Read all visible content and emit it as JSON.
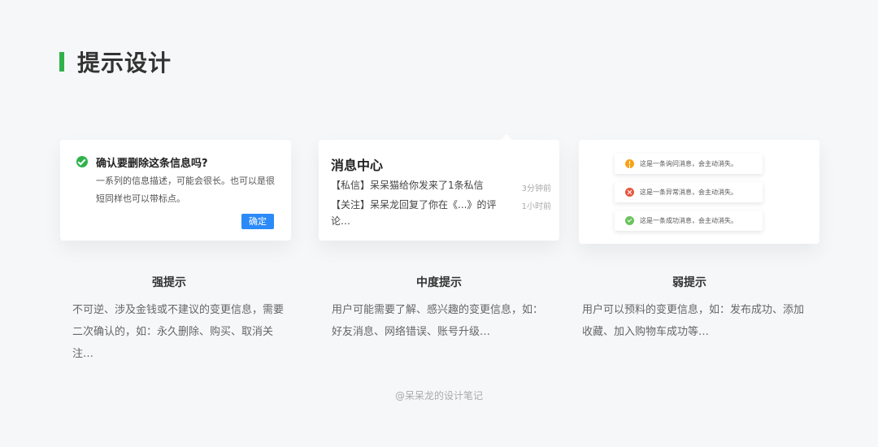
{
  "page": {
    "title": "提示设计",
    "accent_color": "#2fb24a",
    "footer": "@呆呆龙的设计笔记"
  },
  "strong": {
    "card": {
      "icon": "check-circle-icon",
      "title": "确认要删除这条信息吗?",
      "description": "一系列的信息描述，可能会很长。也可以是很短同样也可以带标点。",
      "confirm_label": "确定"
    },
    "heading": "强提示",
    "description": "不可逆、涉及金钱或不建议的变更信息，需要二次确认的，如：永久删除、购买、取消关注…"
  },
  "medium": {
    "card": {
      "title": "消息中心",
      "messages": [
        {
          "text": "【私信】呆呆猫给你发来了1条私信",
          "time": "3分钟前"
        },
        {
          "text": "【关注】呆呆龙回复了你在《...》的评论…",
          "time": "1小时前"
        }
      ]
    },
    "heading": "中度提示",
    "description": "用户可能需要了解、感兴趣的变更信息，如：好友消息、网络错误、账号升级…"
  },
  "weak": {
    "card": {
      "toasts": [
        {
          "icon": "warning-icon",
          "text": "这是一条询问消息，会主动消失。",
          "color": "#f7a318"
        },
        {
          "icon": "error-icon",
          "text": "这是一条异常消息，会主动消失。",
          "color": "#e8573c"
        },
        {
          "icon": "success-icon",
          "text": "这是一条成功消息，会主动消失。",
          "color": "#6bc35e"
        }
      ]
    },
    "heading": "弱提示",
    "description": "用户可以预料的变更信息，如：发布成功、添加收藏、加入购物车成功等…"
  }
}
